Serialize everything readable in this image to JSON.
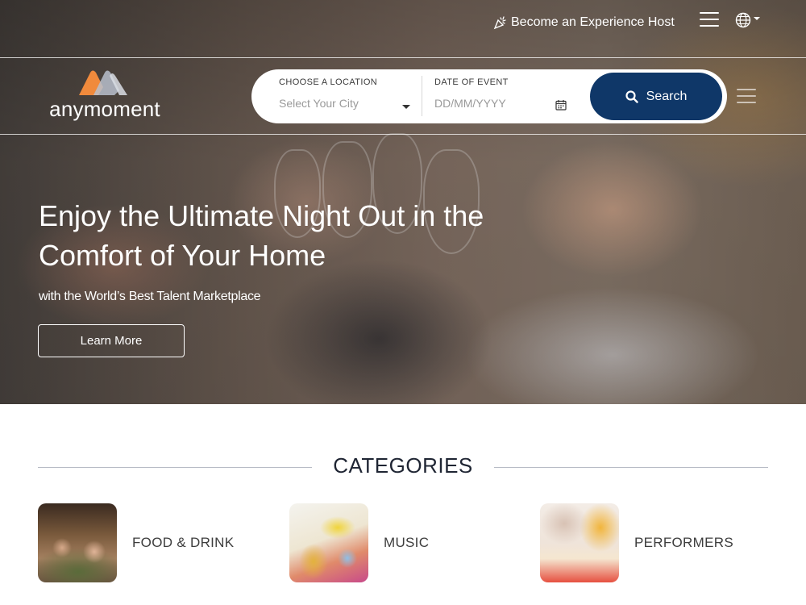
{
  "header": {
    "host_link": "Become an Experience Host",
    "logo_text": "anymoment"
  },
  "search": {
    "location_label": "CHOOSE A LOCATION",
    "location_placeholder": "Select Your City",
    "date_label": "DATE OF EVENT",
    "date_placeholder": "DD/MM/YYYY",
    "button_label": "Search",
    "button_color": "#0f3768"
  },
  "hero": {
    "title": "Enjoy the Ultimate Night Out in the Comfort of Your Home",
    "subtitle": "with the World’s Best Talent Marketplace",
    "cta": "Learn More"
  },
  "categories": {
    "heading": "CATEGORIES",
    "items": [
      {
        "label": "FOOD & DRINK"
      },
      {
        "label": "MUSIC"
      },
      {
        "label": "PERFORMERS"
      }
    ]
  },
  "colors": {
    "brand_orange": "#f08a3c",
    "brand_blue": "#0f3768"
  }
}
